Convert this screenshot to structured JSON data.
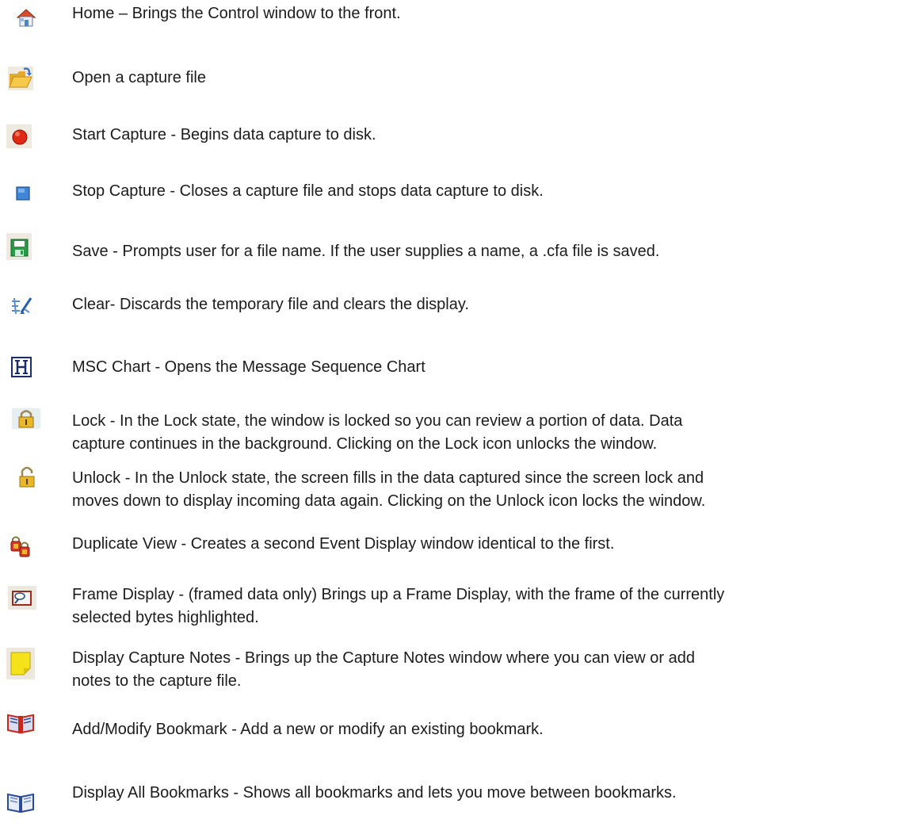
{
  "items": [
    {
      "icon": "home-icon",
      "text": "Home – Brings the Control window to the front."
    },
    {
      "icon": "open-folder-icon",
      "text": "Open a capture file"
    },
    {
      "icon": "start-capture-icon",
      "text": "Start Capture - Begins data capture to disk."
    },
    {
      "icon": "stop-capture-icon",
      "text": "Stop Capture  - Closes a capture file and stops data capture to disk."
    },
    {
      "icon": "save-icon",
      "text": "Save - Prompts user for a file name.  If the user supplies a name, a .cfa file is saved."
    },
    {
      "icon": "clear-icon",
      "text": "Clear- Discards the temporary file and clears the display."
    },
    {
      "icon": "msc-chart-icon",
      "text": "MSC Chart - Opens the Message Sequence Chart"
    },
    {
      "icon": "lock-icon",
      "lines": [
        "Lock - In the Lock state, the window is locked so you can review a portion of data. Data",
        "capture continues in the background. Clicking on the Lock icon unlocks the window."
      ]
    },
    {
      "icon": "unlock-icon",
      "lines": [
        "Unlock - In the Unlock state, the screen fills in the data captured since the screen lock and",
        "moves down to display incoming data again. Clicking on the Unlock icon locks the window."
      ]
    },
    {
      "icon": "duplicate-view-icon",
      "text": "Duplicate View - Creates a second Event Display window identical to the first."
    },
    {
      "icon": "frame-display-icon",
      "lines": [
        "Frame Display - (framed data only) Brings up a Frame Display, with the frame of the currently",
        "selected bytes highlighted."
      ]
    },
    {
      "icon": "capture-notes-icon",
      "lines": [
        "Display Capture Notes - Brings up the Capture Notes window where you can view or add",
        "notes to the capture file."
      ]
    },
    {
      "icon": "add-bookmark-icon",
      "text": "Add/Modify Bookmark - Add a new or modify an existing bookmark."
    },
    {
      "icon": "display-bookmarks-icon",
      "text": "Display All Bookmarks - Shows all bookmarks and lets you move between bookmarks."
    }
  ]
}
